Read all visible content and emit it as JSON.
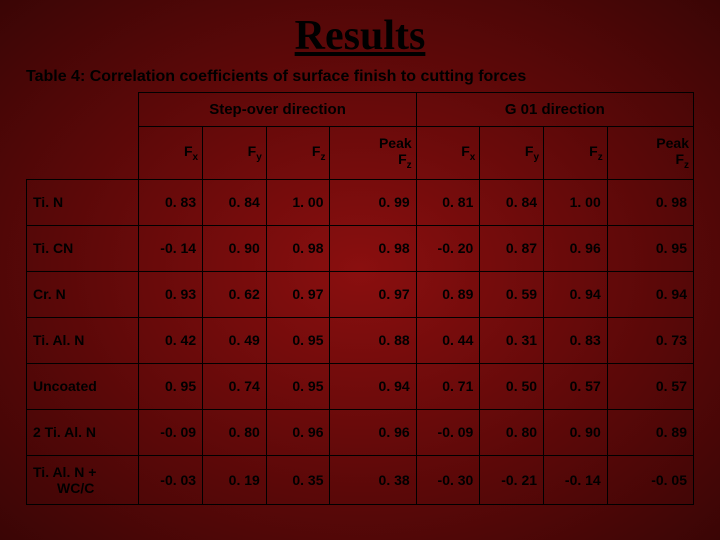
{
  "title": "Results",
  "caption": "Table 4: Correlation coefficients of surface finish to cutting forces",
  "group_headers": {
    "stepover": "Step-over direction",
    "g01": "G 01 direction"
  },
  "sub_headers": {
    "fx": "F",
    "fx_sub": "x",
    "fy": "F",
    "fy_sub": "y",
    "fz": "F",
    "fz_sub": "z",
    "peak_prefix": "Peak",
    "peak_f": "F",
    "peak_sub": "z"
  },
  "rows": [
    {
      "label": "Ti. N",
      "so": [
        "0. 83",
        "0. 84",
        "1. 00",
        "0. 99"
      ],
      "g01": [
        "0. 81",
        "0. 84",
        "1. 00",
        "0. 98"
      ]
    },
    {
      "label": "Ti. CN",
      "so": [
        "-0. 14",
        "0. 90",
        "0. 98",
        "0. 98"
      ],
      "g01": [
        "-0. 20",
        "0. 87",
        "0. 96",
        "0. 95"
      ]
    },
    {
      "label": "Cr. N",
      "so": [
        "0. 93",
        "0. 62",
        "0. 97",
        "0. 97"
      ],
      "g01": [
        "0. 89",
        "0. 59",
        "0. 94",
        "0. 94"
      ]
    },
    {
      "label": "Ti. Al. N",
      "so": [
        "0. 42",
        "0. 49",
        "0. 95",
        "0. 88"
      ],
      "g01": [
        "0. 44",
        "0. 31",
        "0. 83",
        "0. 73"
      ]
    },
    {
      "label": "Uncoated",
      "so": [
        "0. 95",
        "0. 74",
        "0. 95",
        "0. 94"
      ],
      "g01": [
        "0. 71",
        "0. 50",
        "0. 57",
        "0. 57"
      ]
    },
    {
      "label": "2 Ti. Al. N",
      "so": [
        "-0. 09",
        "0. 80",
        "0. 96",
        "0. 96"
      ],
      "g01": [
        "-0. 09",
        "0. 80",
        "0. 90",
        "0. 89"
      ]
    },
    {
      "label": "Ti. Al. N + WC/C",
      "so": [
        "-0. 03",
        "0. 19",
        "0. 35",
        "0. 38"
      ],
      "g01": [
        "-0. 30",
        "-0. 21",
        "-0. 14",
        "-0. 05"
      ]
    }
  ],
  "chart_data": {
    "type": "table",
    "title": "Table 4: Correlation coefficients of surface finish to cutting forces",
    "column_groups": [
      "Step-over direction",
      "G 01 direction"
    ],
    "columns_per_group": [
      "Fx",
      "Fy",
      "Fz",
      "Peak Fz"
    ],
    "row_labels": [
      "Ti.N",
      "Ti.CN",
      "Cr.N",
      "Ti.Al.N",
      "Uncoated",
      "2 Ti.Al.N",
      "Ti.Al.N + WC/C"
    ],
    "stepover": [
      [
        0.83,
        0.84,
        1.0,
        0.99
      ],
      [
        -0.14,
        0.9,
        0.98,
        0.98
      ],
      [
        0.93,
        0.62,
        0.97,
        0.97
      ],
      [
        0.42,
        0.49,
        0.95,
        0.88
      ],
      [
        0.95,
        0.74,
        0.95,
        0.94
      ],
      [
        -0.09,
        0.8,
        0.96,
        0.96
      ],
      [
        -0.03,
        0.19,
        0.35,
        0.38
      ]
    ],
    "g01": [
      [
        0.81,
        0.84,
        1.0,
        0.98
      ],
      [
        -0.2,
        0.87,
        0.96,
        0.95
      ],
      [
        0.89,
        0.59,
        0.94,
        0.94
      ],
      [
        0.44,
        0.31,
        0.83,
        0.73
      ],
      [
        0.71,
        0.5,
        0.57,
        0.57
      ],
      [
        -0.09,
        0.8,
        0.9,
        0.89
      ],
      [
        -0.3,
        -0.21,
        -0.14,
        -0.05
      ]
    ]
  }
}
